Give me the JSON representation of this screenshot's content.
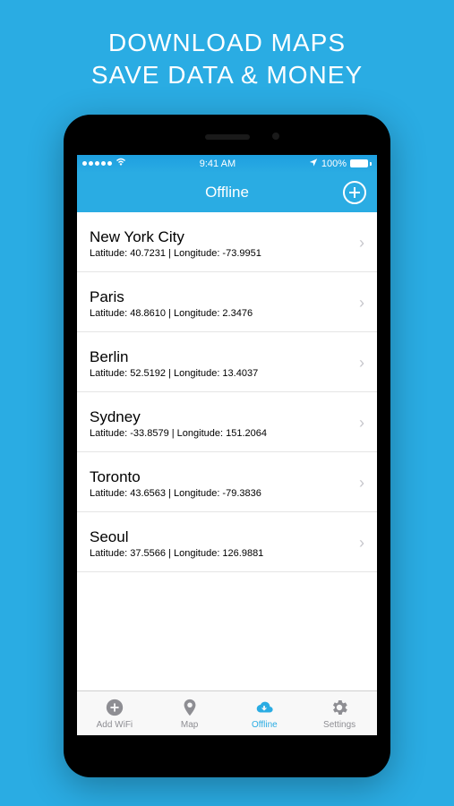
{
  "promo": {
    "line1": "DOWNLOAD MAPS",
    "line2": "SAVE DATA & MONEY"
  },
  "status_bar": {
    "time": "9:41 AM",
    "battery_pct": "100%"
  },
  "header": {
    "title": "Offline"
  },
  "cities": [
    {
      "name": "New York City",
      "coords": "Latitude: 40.7231 | Longitude: -73.9951"
    },
    {
      "name": "Paris",
      "coords": "Latitude: 48.8610 | Longitude: 2.3476"
    },
    {
      "name": "Berlin",
      "coords": "Latitude: 52.5192 | Longitude: 13.4037"
    },
    {
      "name": "Sydney",
      "coords": "Latitude: -33.8579 | Longitude: 151.2064"
    },
    {
      "name": "Toronto",
      "coords": "Latitude: 43.6563 | Longitude: -79.3836"
    },
    {
      "name": "Seoul",
      "coords": "Latitude: 37.5566 | Longitude: 126.9881"
    }
  ],
  "tabs": [
    {
      "label": "Add WiFi",
      "icon": "plus-circle-icon",
      "active": false
    },
    {
      "label": "Map",
      "icon": "map-pin-icon",
      "active": false
    },
    {
      "label": "Offline",
      "icon": "cloud-download-icon",
      "active": true
    },
    {
      "label": "Settings",
      "icon": "gear-icon",
      "active": false
    }
  ]
}
